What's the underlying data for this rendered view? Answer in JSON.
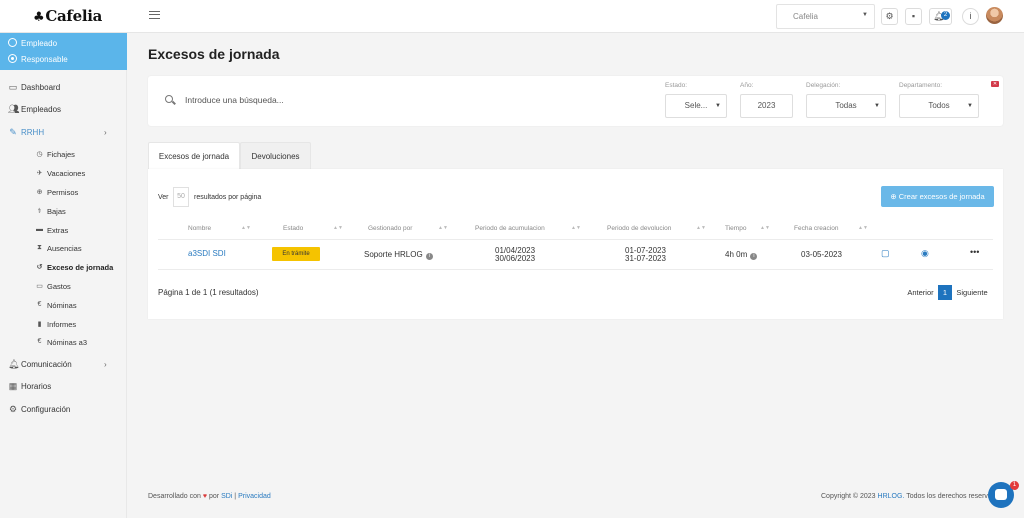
{
  "app": {
    "logo": "Cafelia"
  },
  "topbar": {
    "company_select": "Cafelia",
    "notif_count": "2",
    "icons": [
      "gear-icon",
      "chat-icon",
      "bell-icon",
      "info-icon"
    ]
  },
  "sidebar": {
    "roles": [
      {
        "label": "Empleado",
        "selected": false
      },
      {
        "label": "Responsable",
        "selected": true
      }
    ],
    "nav": {
      "dashboard": "Dashboard",
      "empleados": "Empleados",
      "rrhh": "RRHH",
      "comunicacion": "Comunicación",
      "horarios": "Horarios",
      "configuracion": "Configuración"
    },
    "rrhh_items": [
      "Fichajes",
      "Vacaciones",
      "Permisos",
      "Bajas",
      "Extras",
      "Ausencias",
      "Exceso de jornada",
      "Gastos",
      "Nóminas",
      "Informes",
      "Nóminas a3"
    ]
  },
  "main": {
    "title": "Excesos de jornada",
    "search_placeholder": "Introduce una búsqueda...",
    "filters": {
      "estado": {
        "label": "Estado:",
        "value": "Sele..."
      },
      "anio": {
        "label": "Año:",
        "value": "2023"
      },
      "delegacion": {
        "label": "Delegación:",
        "value": "Todas"
      },
      "departamento": {
        "label": "Departamento:",
        "value": "Todos"
      }
    },
    "tabs": [
      "Excesos de jornada",
      "Devoluciones"
    ],
    "per_page": {
      "ver": "Ver",
      "value": "50",
      "label": "resultados por página"
    },
    "create_button": "Crear excesos de jornada",
    "columns": [
      "Nombre",
      "Estado",
      "Gestionado por",
      "Periodo de acumulacion",
      "Periodo de devolucion",
      "Tiempo",
      "Fecha creacion"
    ],
    "rows": [
      {
        "nombre": "a3SDI SDI",
        "estado": "En trámite",
        "gestionado": "Soporte HRLOG",
        "acum_desde": "01/04/2023",
        "acum_hasta": "30/06/2023",
        "dev_desde": "01-07-2023",
        "dev_hasta": "31-07-2023",
        "tiempo": "4h 0m",
        "fecha": "03-05-2023"
      }
    ],
    "pagination": {
      "info": "Página 1 de 1 (1 resultados)",
      "prev": "Anterior",
      "current": "1",
      "next": "Siguiente"
    }
  },
  "footer": {
    "left_prefix": "Desarrollado con",
    "left_by": "por",
    "left_sdi": "SDi",
    "left_sep": "|",
    "left_privacy": "Privacidad",
    "right_prefix": "Copyright © 2023",
    "right_link": "HRLOG.",
    "right_suffix": "Todos los derechos reservados."
  },
  "chat": {
    "badge": "1"
  },
  "colors": {
    "accent": "#1e73be",
    "sidebar_role": "#5bb5ea",
    "status_pending": "#f5c300",
    "create_button": "#6ab8e8"
  }
}
